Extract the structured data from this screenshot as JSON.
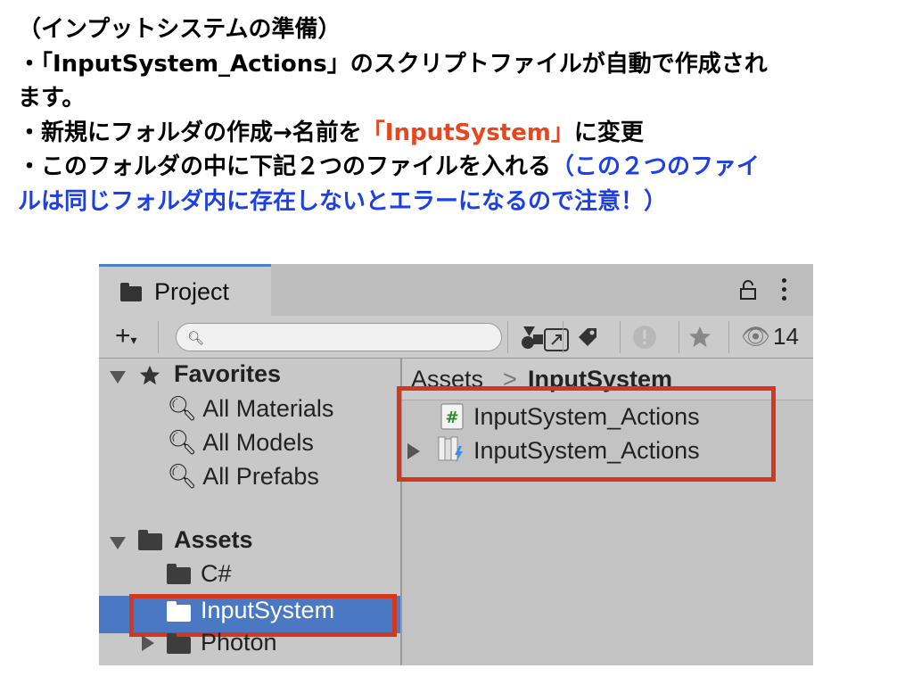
{
  "instructions": {
    "line1": "（インプットシステムの準備）",
    "line2a": "・「InputSystem_Actions」のスクリプトファイルが自動で作成され",
    "line2b": "ます。",
    "line3_pre": "・新規にフォルダの作成→名前を",
    "line3_red": "「InputSystem」",
    "line3_post": "に変更",
    "line4_pre": "・このフォルダの中に下記２つのファイルを入れる",
    "line4_blue": "（この２つのファイ",
    "line5_blue": "ルは同じフォルダ内に存在しないとエラーになるので注意！）"
  },
  "window": {
    "tab_label": "Project",
    "eye_count": "14",
    "search_placeholder": ""
  },
  "sidebar": {
    "favorites_label": "Favorites",
    "favorites": [
      "All Materials",
      "All Models",
      "All Prefabs"
    ],
    "assets_label": "Assets",
    "folders": [
      "C#",
      "InputSystem",
      "Photon"
    ]
  },
  "breadcrumb": {
    "root": "Assets",
    "separator": ">",
    "current": "InputSystem"
  },
  "files": [
    {
      "name": "InputSystem_Actions",
      "icon": "csharp-script-icon"
    },
    {
      "name": "InputSystem_Actions",
      "icon": "input-actions-asset-icon"
    }
  ],
  "colors": {
    "red_highlight": "#d2381f",
    "red_text": "#e8461e",
    "blue_text": "#1c3fe8",
    "selection": "#4a78c2"
  }
}
